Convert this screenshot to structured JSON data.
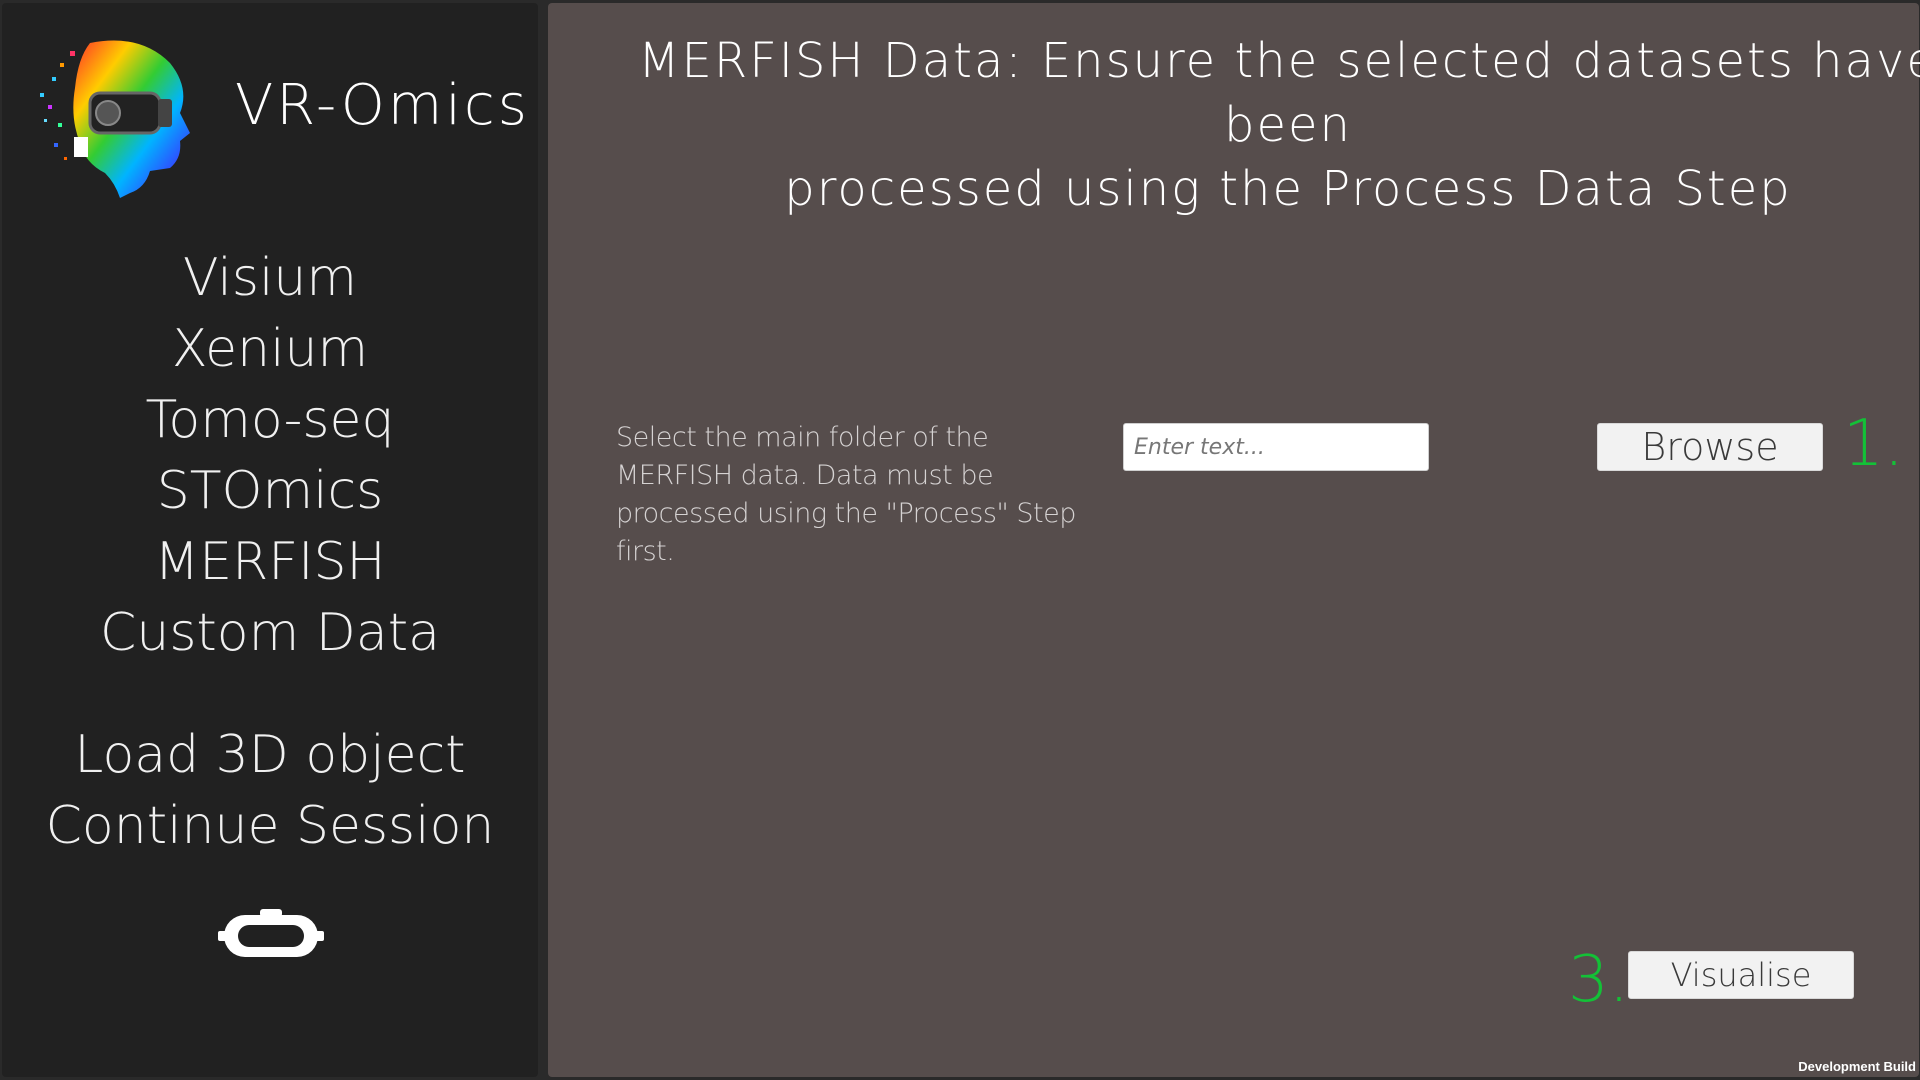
{
  "sidebar": {
    "app_title": "VR-Omics",
    "nav_items": [
      {
        "label": "Visium"
      },
      {
        "label": "Xenium"
      },
      {
        "label": "Tomo-seq"
      },
      {
        "label": "STOmics"
      },
      {
        "label": "MERFISH"
      },
      {
        "label": "Custom Data"
      }
    ],
    "session_items": [
      {
        "label": "Load 3D object"
      },
      {
        "label": "Continue Session"
      }
    ],
    "headset_icon": "vr-headset-icon"
  },
  "main": {
    "heading_line1": "MERFISH Data: Ensure the selected datasets have been",
    "heading_line2": "processed using the Process Data Step",
    "description": "Select the main folder of the MERFISH data. Data must be processed using the \"Process\" Step first.",
    "folder_input": {
      "placeholder": "Enter text...",
      "value": ""
    },
    "browse_label": "Browse",
    "step1_label": "1.",
    "step3_label": "3.",
    "visualise_label": "Visualise"
  },
  "footer": {
    "build_label": "Development Build"
  },
  "colors": {
    "sidebar_bg": "#212121",
    "main_bg": "#564d4c",
    "step_green": "#13c137"
  }
}
